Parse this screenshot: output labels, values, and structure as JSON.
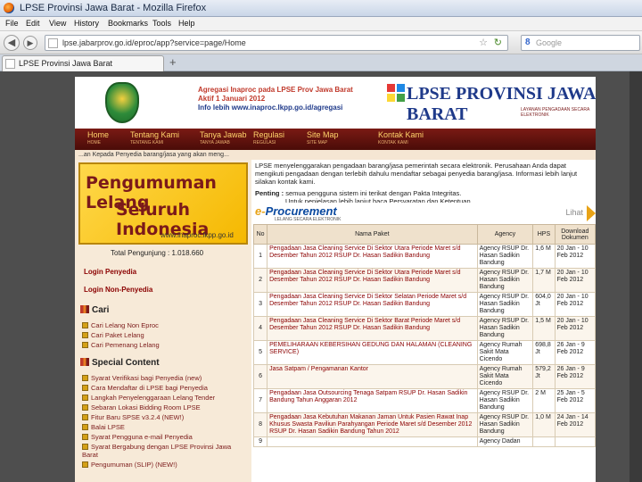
{
  "window": {
    "title": "LPSE Provinsi Jawa Barat - Mozilla Firefox"
  },
  "menu": [
    "File",
    "Edit",
    "View",
    "History",
    "Bookmarks",
    "Tools",
    "Help"
  ],
  "nav": {
    "url": "lpse.jabarprov.go.id/eproc/app?service=page/Home",
    "search_placeholder": "Google",
    "search_icon_text": "8"
  },
  "tab": {
    "label": "LPSE Provinsi Jawa Barat",
    "new_tab": "+"
  },
  "header": {
    "agregasi_1": "Agregasi Inaproc pada LPSE Prov Jawa Barat",
    "agregasi_2": "Aktif 1 Januari 2012",
    "agregasi_3": "Info lebih www.inaproc.lkpp.go.id/agregasi",
    "logo_text": "LPSE PROVINSI JAWA BARAT",
    "logo_sub": "LAYANAN PENGADAAN SECARA ELEKTRONIK"
  },
  "mainnav": [
    {
      "label": "Home",
      "sub": "HOME"
    },
    {
      "label": "Tentang Kami",
      "sub": "TENTANG KAMI"
    },
    {
      "label": "Tanya Jawab",
      "sub": "TANYA JAWAB"
    },
    {
      "label": "Regulasi",
      "sub": "REGULASI"
    },
    {
      "label": "Site Map",
      "sub": "SITE MAP"
    },
    {
      "label": "Kontak Kami",
      "sub": "KONTAK KAMI"
    }
  ],
  "marquee": "...an Kepada Penyedia barang/jasa yang akan meng...",
  "sidebar": {
    "banner_l1": "Pengumuman Lelang",
    "banner_l2": "Seluruh Indonesia",
    "banner_url": "www.inaproc.lkpp.go.id",
    "total": "Total Pengunjung : 1.018.660",
    "login_penyedia": "Login Penyedia",
    "login_non": "Login Non-Penyedia",
    "cari_head": "Cari",
    "cari_items": [
      "Cari Lelang Non Eproc",
      "Cari Paket Lelang",
      "Cari Pemenang Lelang"
    ],
    "special_head": "Special Content",
    "special_items": [
      "Syarat Verifikasi bagi Penyedia (new)",
      "Cara Mendaftar di LPSE bagi Penyedia",
      "Langkah Penyelenggaraan Lelang Tender",
      "Sebaran Lokasi Bidding Room LPSE",
      "Fitur Baru SPSE v3.2.4 (NEW!)",
      "Balai LPSE",
      "Syarat Pengguna e-mail Penyedia",
      "Syarat Bergabung dengan LPSE Provinsi Jawa Barat",
      "Pengumuman (SLIP) (NEW!)"
    ]
  },
  "content": {
    "intro": "LPSE menyelenggarakan pengadaan barang/jasa pemerintah secara elektronik. Perusahaan Anda dapat mengikuti pengadaan dengan terlebih dahulu mendaftar sebagai penyedia barang/jasa. Informasi lebih lanjut silakan kontak kami.",
    "penting_label": "Penting :",
    "penting_1": "semua pengguna sistem ini terikat dengan Pakta Integritas.",
    "penting_2": "Untuk penjelasan lebih lanjut baca Persyaratan dan Ketentuan.",
    "eproc_e": "e-",
    "eproc_title": "Procurement",
    "eproc_sub": "LELANG SECARA ELEKTRONIK",
    "more": "Lihat",
    "table_headers": [
      "No",
      "Nama Paket",
      "Agency",
      "HPS",
      "Download Dokumen"
    ],
    "rows": [
      {
        "no": "1",
        "name": "Pengadaan Jasa Cleaning Service Di Sektor Utara Periode Maret s/d Desember Tahun 2012 RSUP Dr. Hasan Sadikin Bandung",
        "agency": "Agency RSUP Dr. Hasan Sadikin Bandung",
        "hps": "1,6 M",
        "date": "20 Jan - 10 Feb 2012"
      },
      {
        "no": "2",
        "name": "Pengadaan Jasa Cleaning Service Di Sektor Utara Periode Maret s/d Desember Tahun 2012 RSUP Dr. Hasan Sadikin Bandung",
        "agency": "Agency RSUP Dr. Hasan Sadikin Bandung",
        "hps": "1,7 M",
        "date": "20 Jan - 10 Feb 2012"
      },
      {
        "no": "3",
        "name": "Pengadaan Jasa Cleaning Service Di Sektor Selatan Periode Maret s/d Desember Tahun 2012 RSUP Dr. Hasan Sadikin Bandung",
        "agency": "Agency RSUP Dr. Hasan Sadikin Bandung",
        "hps": "604,0 Jt",
        "date": "20 Jan - 10 Feb 2012"
      },
      {
        "no": "4",
        "name": "Pengadaan Jasa Cleaning Service Di Sektor Barat Periode Maret s/d Desember Tahun 2012 RSUP Dr. Hasan Sadikin Bandung",
        "agency": "Agency RSUP Dr. Hasan Sadikin Bandung",
        "hps": "1,5 M",
        "date": "20 Jan - 10 Feb 2012"
      },
      {
        "no": "5",
        "name": "PEMELIHARAAN KEBERSIHAN GEDUNG DAN HALAMAN (CLEANING SERVICE)",
        "agency": "Agency Rumah Sakit Mata Cicendo",
        "hps": "698,8 Jt",
        "date": "26 Jan - 9 Feb 2012"
      },
      {
        "no": "6",
        "name": "Jasa Satpam / Pengamanan Kantor",
        "agency": "Agency Rumah Sakit Mata Cicendo",
        "hps": "579,2 Jt",
        "date": "26 Jan - 9 Feb 2012"
      },
      {
        "no": "7",
        "name": "Pengadaan Jasa Outsourcing Tenaga Satpam RSUP Dr. Hasan Sadikin Bandung Tahun Anggaran 2012",
        "agency": "Agency RSUP Dr. Hasan Sadikin Bandung",
        "hps": "2 M",
        "date": "25 Jan - 5 Feb 2012"
      },
      {
        "no": "8",
        "name": "Pengadaan Jasa Kebutuhan Makanan Jaman Untuk Pasien Rawat Inap Khusus Swasta Paviliun Parahyangan Periode Maret s/d Desember 2012 RSUP Dr. Hasan Sadikin Bandung Tahun 2012",
        "agency": "Agency RSUP Dr. Hasan Sadikin Bandung",
        "hps": "1,0 M",
        "date": "24 Jan - 14 Feb 2012"
      },
      {
        "no": "9",
        "name": "",
        "agency": "Agency Dadan",
        "hps": "",
        "date": ""
      }
    ]
  }
}
